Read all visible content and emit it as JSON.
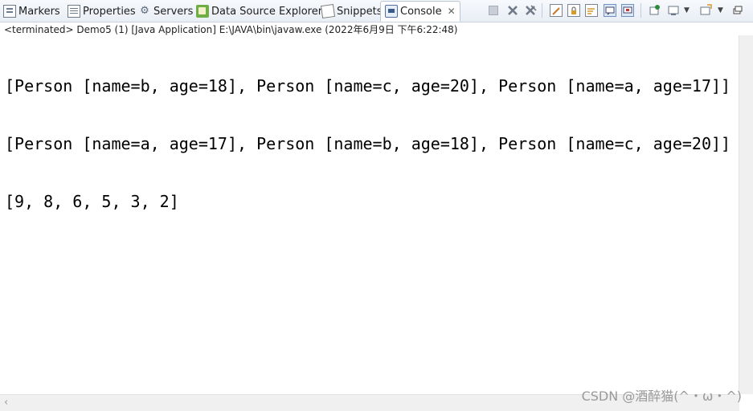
{
  "tabs": [
    {
      "label": "Markers"
    },
    {
      "label": "Properties"
    },
    {
      "label": "Servers"
    },
    {
      "label": "Data Source Explorer"
    },
    {
      "label": "Snippets"
    },
    {
      "label": "Console",
      "close_symbol": "✕"
    }
  ],
  "console": {
    "status": "<terminated> Demo5 (1) [Java Application] E:\\JAVA\\bin\\javaw.exe (2022年6月9日 下午6:22:48)",
    "lines": [
      "[Person [name=b, age=18], Person [name=c, age=20], Person [name=a, age=17]]",
      "[Person [name=a, age=17], Person [name=b, age=18], Person [name=c, age=20]]",
      "[9, 8, 6, 5, 3, 2]"
    ]
  },
  "watermark": "CSDN @酒醉猫(^・ω・^)",
  "scroll_left_arrow": "‹"
}
